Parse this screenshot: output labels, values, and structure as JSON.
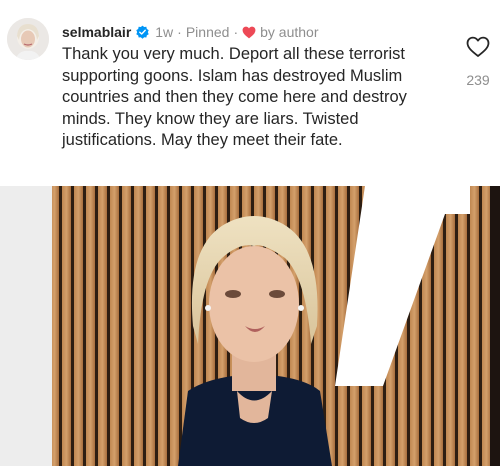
{
  "comment": {
    "username": "selmablair",
    "verified": true,
    "time": "1w",
    "separator": "·",
    "pinned": "Pinned",
    "liked_by": "by author",
    "text": "Thank you very much. Deport all these terrorist supporting goons. Islam has destroyed Muslim countries and then they come here and destroy minds.  They know they are liars. Twisted justifications. May they meet their fate.",
    "like_count": "239"
  },
  "icons": {
    "verified": "verified-badge-icon",
    "author_heart": "heart-filled-icon",
    "like": "heart-outline-icon"
  },
  "colors": {
    "verified_blue": "#0095f6",
    "author_heart_red": "#ed4956",
    "text": "#262626",
    "secondary_text": "#8e8e8e"
  }
}
